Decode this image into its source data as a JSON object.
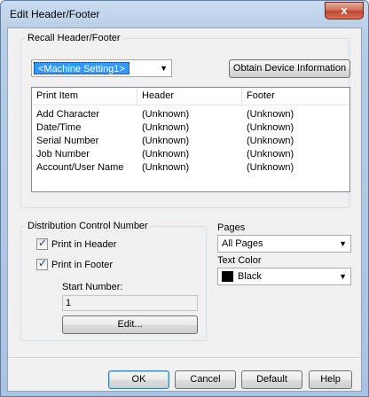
{
  "window": {
    "title": "Edit Header/Footer",
    "close_label": "x"
  },
  "recall": {
    "group_label": "Recall Header/Footer",
    "selected_setting": "<Machine Setting1>",
    "obtain_button": "Obtain Device Information",
    "columns": [
      "Print Item",
      "Header",
      "Footer"
    ],
    "rows": [
      {
        "item": "Add Character",
        "header": "(Unknown)",
        "footer": "(Unknown)"
      },
      {
        "item": "Date/Time",
        "header": "(Unknown)",
        "footer": "(Unknown)"
      },
      {
        "item": "Serial Number",
        "header": "(Unknown)",
        "footer": "(Unknown)"
      },
      {
        "item": "Job Number",
        "header": "(Unknown)",
        "footer": "(Unknown)"
      },
      {
        "item": "Account/User Name",
        "header": "(Unknown)",
        "footer": "(Unknown)"
      }
    ]
  },
  "distribution": {
    "group_label": "Distribution Control Number",
    "print_in_header": "Print in Header",
    "print_in_header_checked": true,
    "print_in_footer": "Print in Footer",
    "print_in_footer_checked": true,
    "start_number_label": "Start Number:",
    "start_number_value": "1",
    "edit_button": "Edit..."
  },
  "pages": {
    "label": "Pages",
    "value": "All Pages"
  },
  "text_color": {
    "label": "Text Color",
    "value": "Black",
    "swatch_color": "#000000"
  },
  "footer_buttons": {
    "ok": "OK",
    "cancel": "Cancel",
    "default": "Default",
    "help": "Help"
  }
}
